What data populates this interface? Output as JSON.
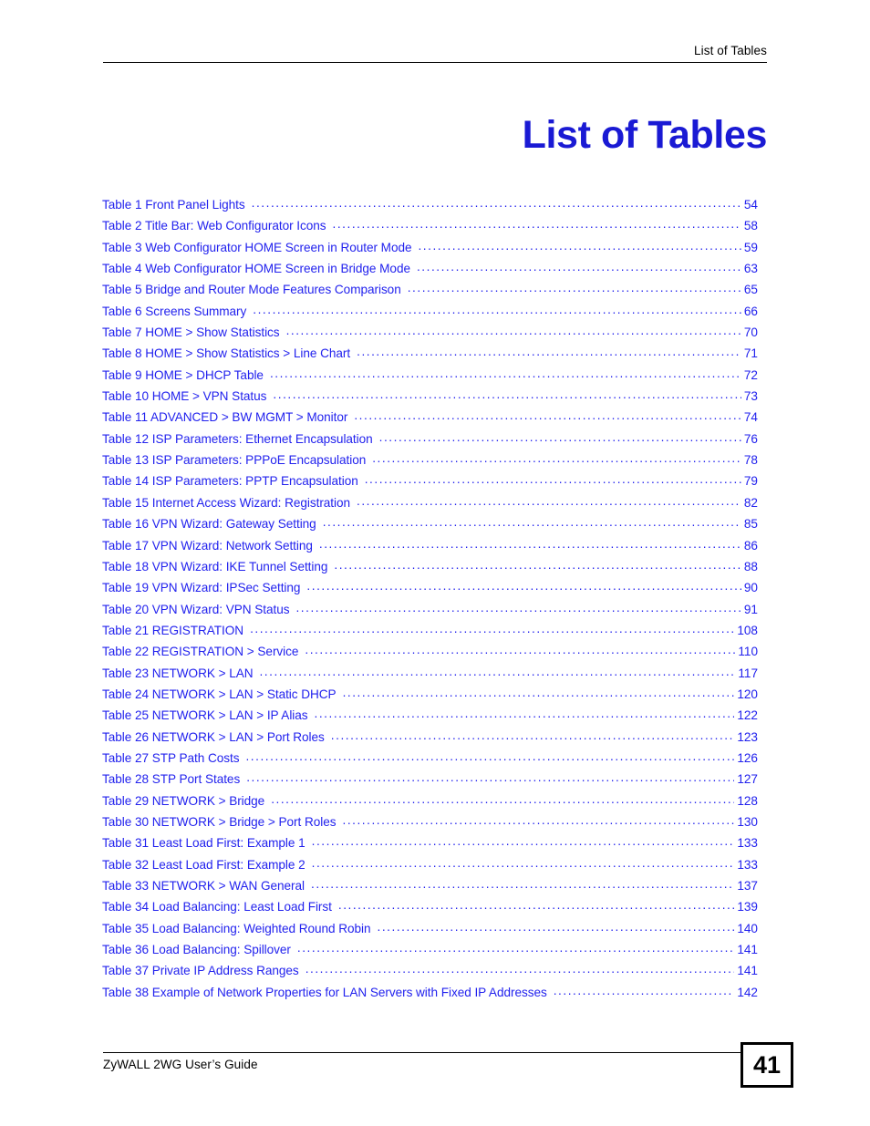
{
  "header": {
    "running_head": "List of Tables"
  },
  "title": "List of Tables",
  "colors": {
    "link_blue": "#2222ee",
    "title_blue": "#1a1ad4",
    "rule_black": "#000000"
  },
  "toc": {
    "entries": [
      {
        "label": "Table 1 Front Panel Lights",
        "page": "54"
      },
      {
        "label": "Table 2 Title Bar: Web Configurator Icons",
        "page": "58"
      },
      {
        "label": "Table 3 Web Configurator HOME Screen in Router Mode",
        "page": "59"
      },
      {
        "label": "Table 4 Web Configurator HOME Screen in Bridge Mode",
        "page": "63"
      },
      {
        "label": "Table 5 Bridge and Router Mode Features Comparison",
        "page": "65"
      },
      {
        "label": "Table 6 Screens Summary",
        "page": "66"
      },
      {
        "label": "Table 7 HOME > Show Statistics",
        "page": "70"
      },
      {
        "label": "Table 8 HOME > Show Statistics > Line Chart",
        "page": "71"
      },
      {
        "label": "Table 9 HOME > DHCP Table",
        "page": "72"
      },
      {
        "label": "Table 10 HOME > VPN Status",
        "page": "73"
      },
      {
        "label": "Table 11 ADVANCED > BW MGMT > Monitor",
        "page": "74"
      },
      {
        "label": "Table 12 ISP Parameters: Ethernet Encapsulation",
        "page": "76"
      },
      {
        "label": "Table 13 ISP Parameters: PPPoE Encapsulation",
        "page": "78"
      },
      {
        "label": "Table 14 ISP Parameters: PPTP Encapsulation",
        "page": "79"
      },
      {
        "label": "Table 15 Internet Access Wizard: Registration",
        "page": "82"
      },
      {
        "label": "Table 16 VPN Wizard: Gateway Setting",
        "page": "85"
      },
      {
        "label": "Table 17 VPN Wizard: Network Setting",
        "page": "86"
      },
      {
        "label": "Table 18 VPN Wizard: IKE Tunnel Setting",
        "page": "88"
      },
      {
        "label": "Table 19 VPN Wizard: IPSec Setting",
        "page": "90"
      },
      {
        "label": "Table 20 VPN Wizard: VPN Status",
        "page": "91"
      },
      {
        "label": "Table 21 REGISTRATION",
        "page": "108"
      },
      {
        "label": "Table 22 REGISTRATION > Service",
        "page": "110"
      },
      {
        "label": "Table 23 NETWORK > LAN",
        "page": "117"
      },
      {
        "label": "Table 24 NETWORK > LAN > Static DHCP",
        "page": "120"
      },
      {
        "label": "Table 25 NETWORK > LAN > IP Alias",
        "page": "122"
      },
      {
        "label": "Table 26 NETWORK > LAN > Port Roles",
        "page": "123"
      },
      {
        "label": "Table 27 STP Path Costs",
        "page": "126"
      },
      {
        "label": "Table 28 STP Port States",
        "page": "127"
      },
      {
        "label": "Table 29 NETWORK > Bridge",
        "page": "128"
      },
      {
        "label": "Table 30 NETWORK > Bridge > Port Roles",
        "page": "130"
      },
      {
        "label": "Table 31 Least Load First: Example 1",
        "page": "133"
      },
      {
        "label": "Table 32 Least Load First: Example 2",
        "page": "133"
      },
      {
        "label": "Table 33 NETWORK > WAN General",
        "page": "137"
      },
      {
        "label": "Table 34 Load Balancing: Least Load First",
        "page": "139"
      },
      {
        "label": "Table 35 Load Balancing: Weighted Round Robin",
        "page": "140"
      },
      {
        "label": "Table 36 Load Balancing: Spillover",
        "page": "141"
      },
      {
        "label": "Table 37 Private IP Address Ranges",
        "page": "141"
      },
      {
        "label": "Table 38 Example of Network Properties for LAN Servers with Fixed IP Addresses",
        "page": "142"
      }
    ]
  },
  "footer": {
    "guide_title": "ZyWALL 2WG User’s Guide",
    "page_number": "41"
  }
}
